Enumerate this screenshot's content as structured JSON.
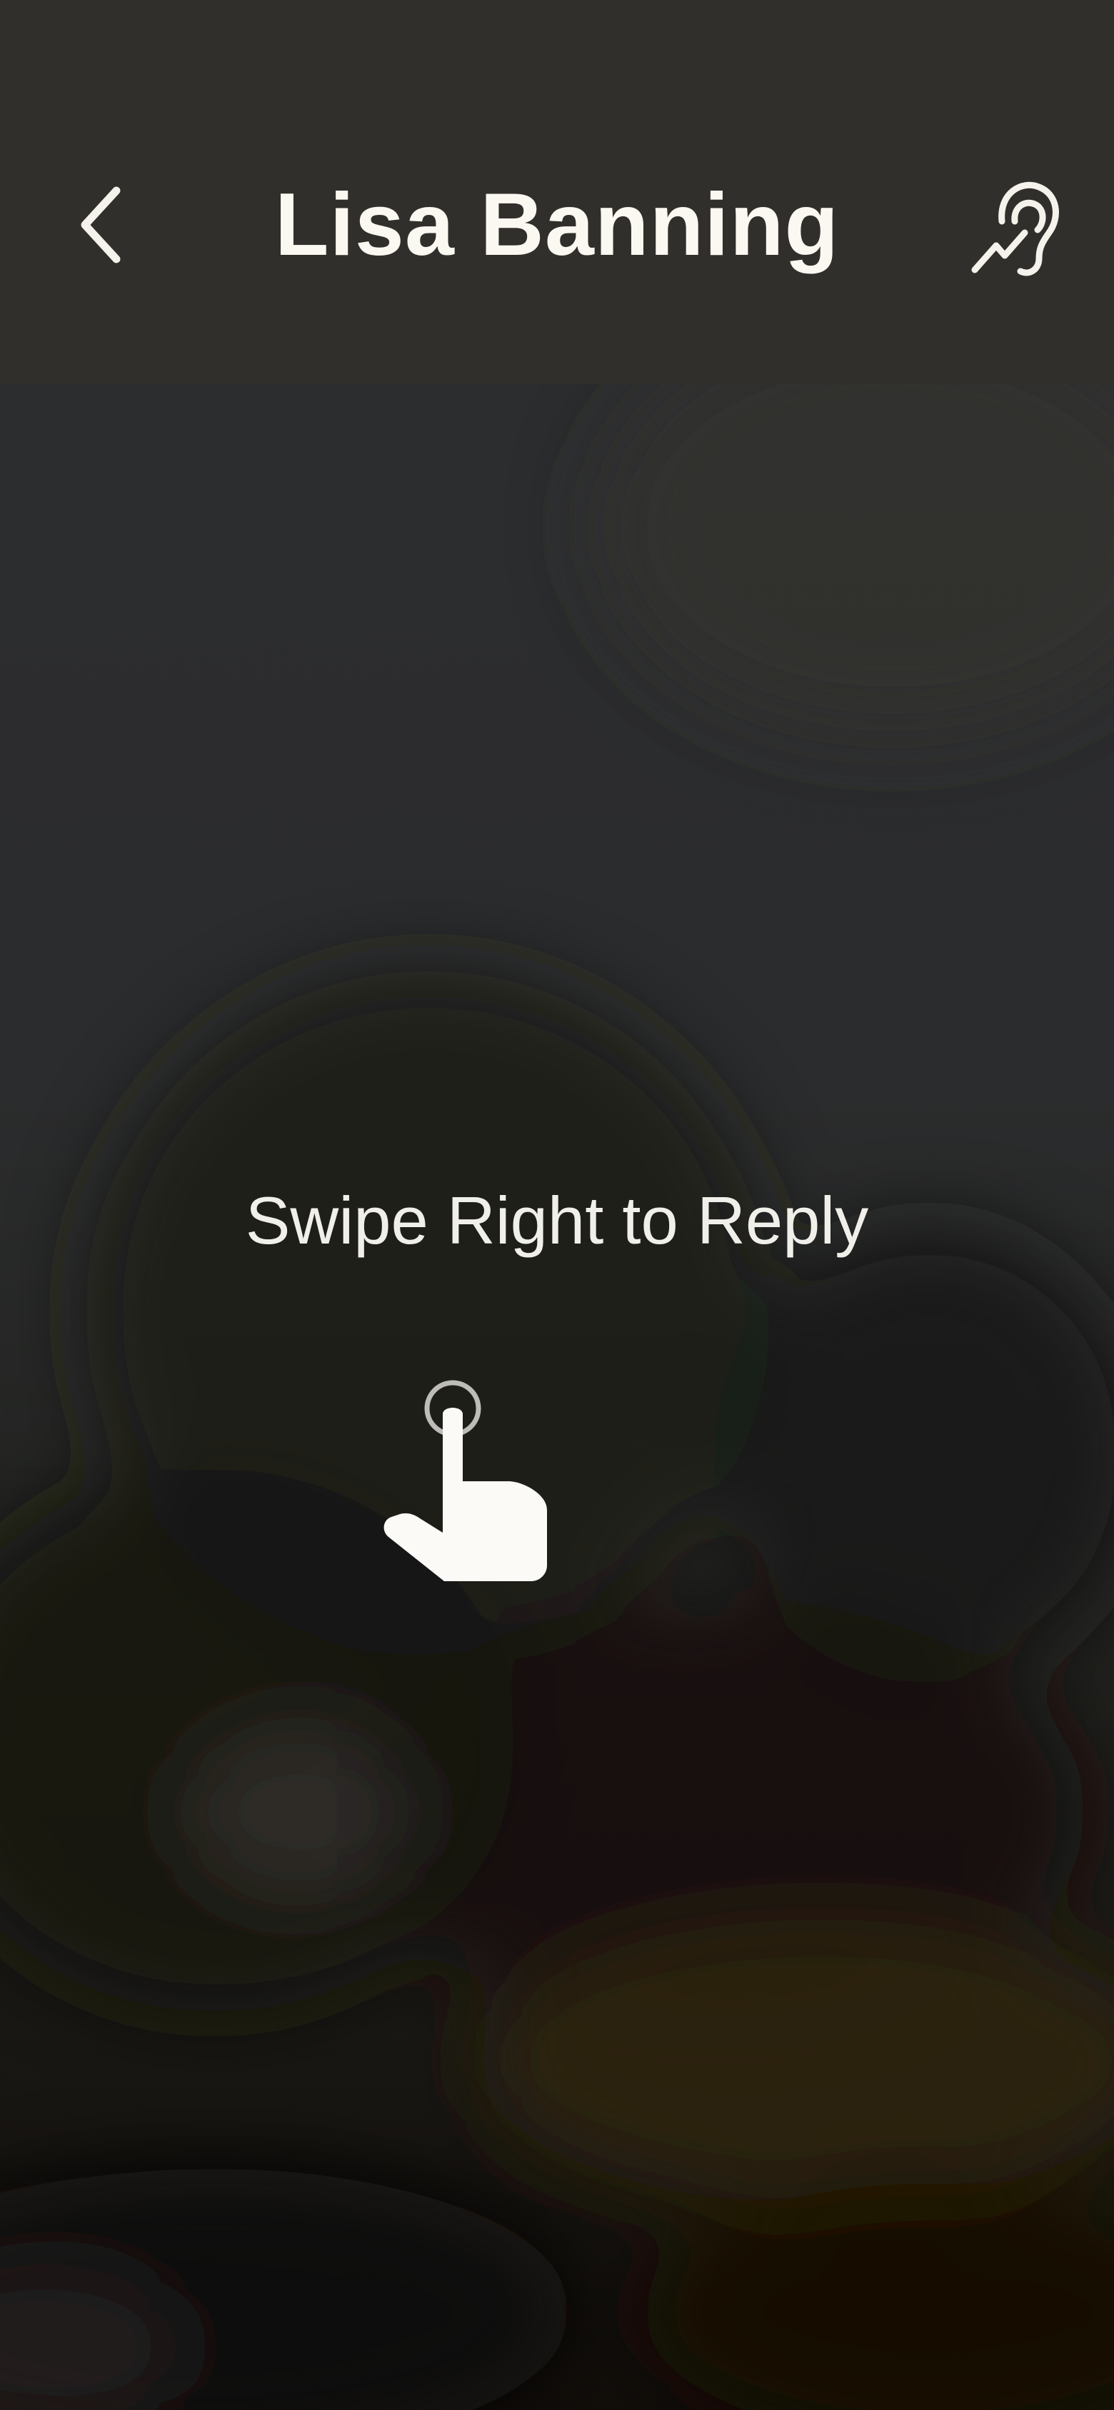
{
  "header": {
    "title": "Lisa Banning",
    "back_icon": "chevron-left-icon",
    "hearing_icon": "hearing-assist-icon"
  },
  "overlay": {
    "hint": "Swipe Right to Reply",
    "gesture_icon": "tap-hand-icon"
  },
  "colors": {
    "header_bg": "#312f2b",
    "text": "#fbf8f1",
    "overlay_bg": "#2b2b2b"
  }
}
